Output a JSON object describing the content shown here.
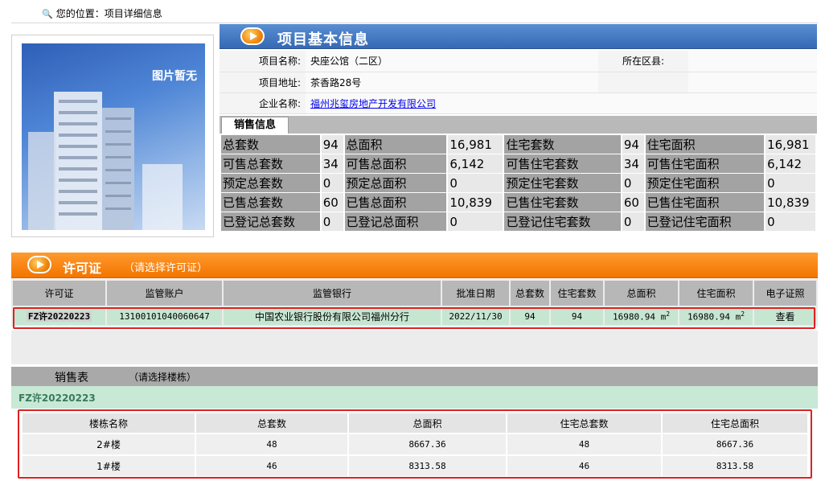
{
  "breadcrumb": {
    "prefix": "您的位置：",
    "current": "项目详细信息"
  },
  "photo": {
    "caption": "图片暂无"
  },
  "project": {
    "section_title": "项目基本信息",
    "name_label": "项目名称:",
    "name": "央座公馆（二区）",
    "district_label": "所在区县:",
    "district": "",
    "address_label": "项目地址:",
    "address": "茶香路28号",
    "company_label": "企业名称:",
    "company": "福州兆玺房地产开发有限公司"
  },
  "sales_info": {
    "tab_label": "销售信息",
    "rows": [
      [
        {
          "k": "总套数",
          "v": "94"
        },
        {
          "k": "总面积",
          "v": "16,981"
        },
        {
          "k": "住宅套数",
          "v": "94"
        },
        {
          "k": "住宅面积",
          "v": "16,981"
        }
      ],
      [
        {
          "k": "可售总套数",
          "v": "34"
        },
        {
          "k": "可售总面积",
          "v": "6,142"
        },
        {
          "k": "可售住宅套数",
          "v": "34"
        },
        {
          "k": "可售住宅面积",
          "v": "6,142"
        }
      ],
      [
        {
          "k": "预定总套数",
          "v": "0"
        },
        {
          "k": "预定总面积",
          "v": "0"
        },
        {
          "k": "预定住宅套数",
          "v": "0"
        },
        {
          "k": "预定住宅面积",
          "v": "0"
        }
      ],
      [
        {
          "k": "已售总套数",
          "v": "60"
        },
        {
          "k": "已售总面积",
          "v": "10,839"
        },
        {
          "k": "已售住宅套数",
          "v": "60"
        },
        {
          "k": "已售住宅面积",
          "v": "10,839"
        }
      ],
      [
        {
          "k": "已登记总套数",
          "v": "0"
        },
        {
          "k": "已登记总面积",
          "v": "0"
        },
        {
          "k": "已登记住宅套数",
          "v": "0"
        },
        {
          "k": "已登记住宅面积",
          "v": "0"
        }
      ]
    ]
  },
  "permits": {
    "title": "许可证",
    "hint": "（请选择许可证）",
    "columns": [
      "许可证",
      "监管账户",
      "监管银行",
      "批准日期",
      "总套数",
      "住宅套数",
      "总面积",
      "住宅面积",
      "电子证照"
    ],
    "row": {
      "permit_id": "FZ许20220223",
      "account": "13100101040060647",
      "bank": "中国农业银行股份有限公司福州分行",
      "date": "2022/11/30",
      "total_units": "94",
      "residential_units": "94",
      "total_area": "16980.94 m",
      "residential_area": "16980.94 m",
      "area_unit_sup": "2",
      "cert_link": "查看"
    }
  },
  "sales_table": {
    "label": "销售表",
    "hint": "（请选择楼栋）",
    "permit_id": "FZ许20220223",
    "columns": [
      "楼栋名称",
      "总套数",
      "总面积",
      "住宅总套数",
      "住宅总面积"
    ],
    "rows": [
      [
        "2#楼",
        "48",
        "8667.36",
        "48",
        "8667.36"
      ],
      [
        "1#楼",
        "46",
        "8313.58",
        "46",
        "8313.58"
      ]
    ]
  },
  "colors": {
    "blue_header": "#3569b4",
    "orange_header": "#f27500",
    "highlight": "#e02020",
    "row_green": "#c6e6d2"
  }
}
